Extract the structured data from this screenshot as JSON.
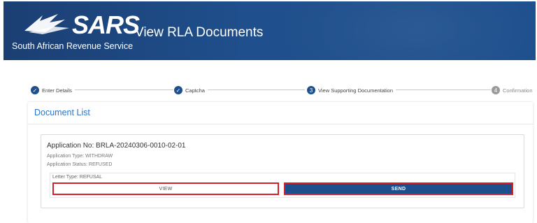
{
  "header": {
    "logo_text": "SARS",
    "org_name": "South African Revenue Service",
    "page_title": "View RLA Documents"
  },
  "stepper": {
    "steps": [
      {
        "label": "Enter Details",
        "state": "completed",
        "marker": "✓"
      },
      {
        "label": "Captcha",
        "state": "completed",
        "marker": "✓"
      },
      {
        "label": "View Supporting Documentation",
        "state": "current",
        "marker": "3"
      },
      {
        "label": "Confirmation",
        "state": "pending",
        "marker": "4"
      }
    ]
  },
  "document_list": {
    "title": "Document List",
    "application": {
      "number": "Application No: BRLA-20240306-0010-02-01",
      "type": "Application Type: WITHDRAW",
      "status": "Application Status: REFUSED",
      "letter": {
        "type": "Letter Type: REFUSAL",
        "view_label": "VIEW",
        "send_label": "SEND"
      }
    }
  },
  "colors": {
    "brand_blue": "#1f4f8c",
    "link_blue": "#2b74c7",
    "highlight_red": "#d81e28"
  }
}
